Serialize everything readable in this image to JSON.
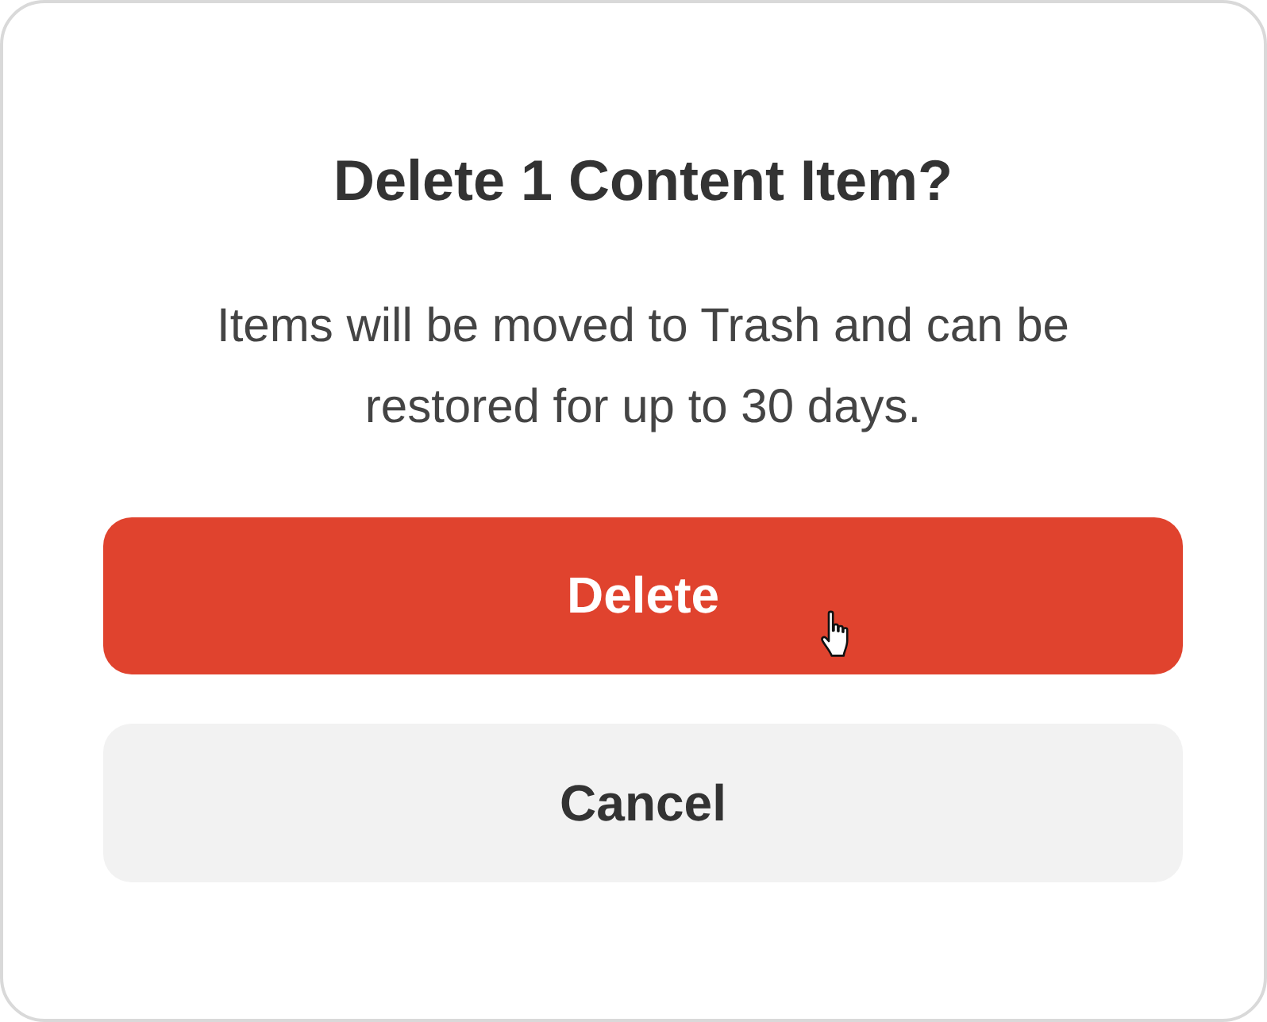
{
  "dialog": {
    "title": "Delete 1 Content Item?",
    "message": "Items will be moved to Trash and can be restored for up to 30 days.",
    "buttons": [
      {
        "label": "Delete",
        "kind": "danger",
        "hovered": true
      },
      {
        "label": "Cancel",
        "kind": "secondary",
        "hovered": false
      }
    ]
  }
}
